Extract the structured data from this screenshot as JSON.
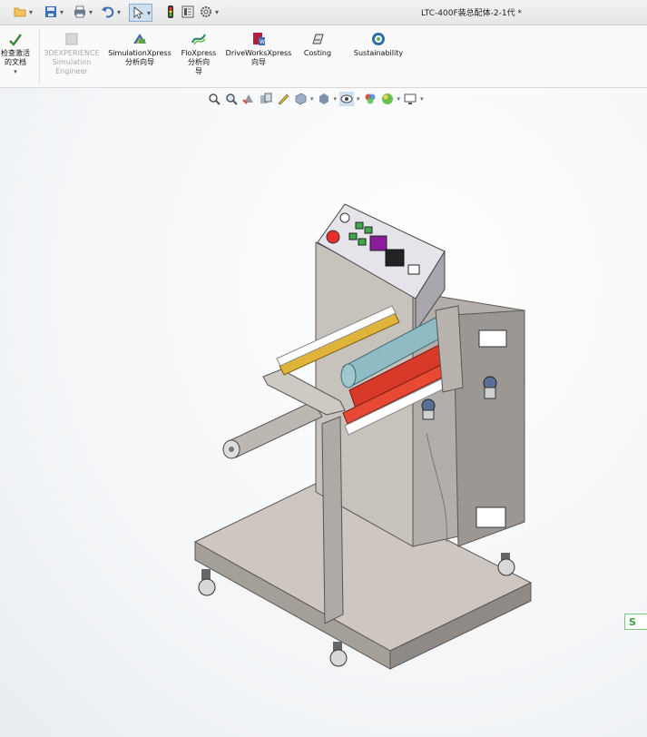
{
  "window": {
    "title": "LTC-400F装总配体-2-1代 *"
  },
  "quick_access": {
    "items": [
      "open-icon",
      "save-icon",
      "print-icon",
      "undo-icon",
      "select-icon",
      "rebuild-icon",
      "file-properties-icon",
      "options-icon"
    ]
  },
  "ribbon": {
    "left_cmd_line1": "检查激活",
    "left_cmd_line2": "的文档",
    "buttons": [
      {
        "line1": "3DEXPERIENCE",
        "line2": "Simulation",
        "line3": "Engineer",
        "disabled": true
      },
      {
        "line1": "SimulationXpress",
        "line2": "分析向导",
        "line3": "",
        "disabled": false
      },
      {
        "line1": "FloXpress",
        "line2": "分析向",
        "line3": "导",
        "disabled": false
      },
      {
        "line1": "DriveWorksXpress",
        "line2": "向导",
        "line3": "",
        "disabled": false
      },
      {
        "line1": "Costing",
        "line2": "",
        "line3": "",
        "disabled": false
      },
      {
        "line1": "Sustainability",
        "line2": "",
        "line3": "",
        "disabled": false
      }
    ]
  },
  "view_toolbar": {
    "items": [
      "zoom-to-fit-icon",
      "zoom-area-icon",
      "previous-view-icon",
      "section-view-icon",
      "dynamic-annotation-icon",
      "view-orientation-icon",
      "display-style-icon",
      "hide-show-icon",
      "edit-appearance-icon",
      "apply-scene-icon",
      "view-settings-icon"
    ]
  },
  "colors": {
    "frame": "#c9c3bf",
    "frame_dark": "#8f8a86",
    "roller_teal": "#8fbcc4",
    "roller_red": "#d83a2a",
    "roller_yellow": "#e0b43a",
    "panel": "#d9d7de"
  }
}
